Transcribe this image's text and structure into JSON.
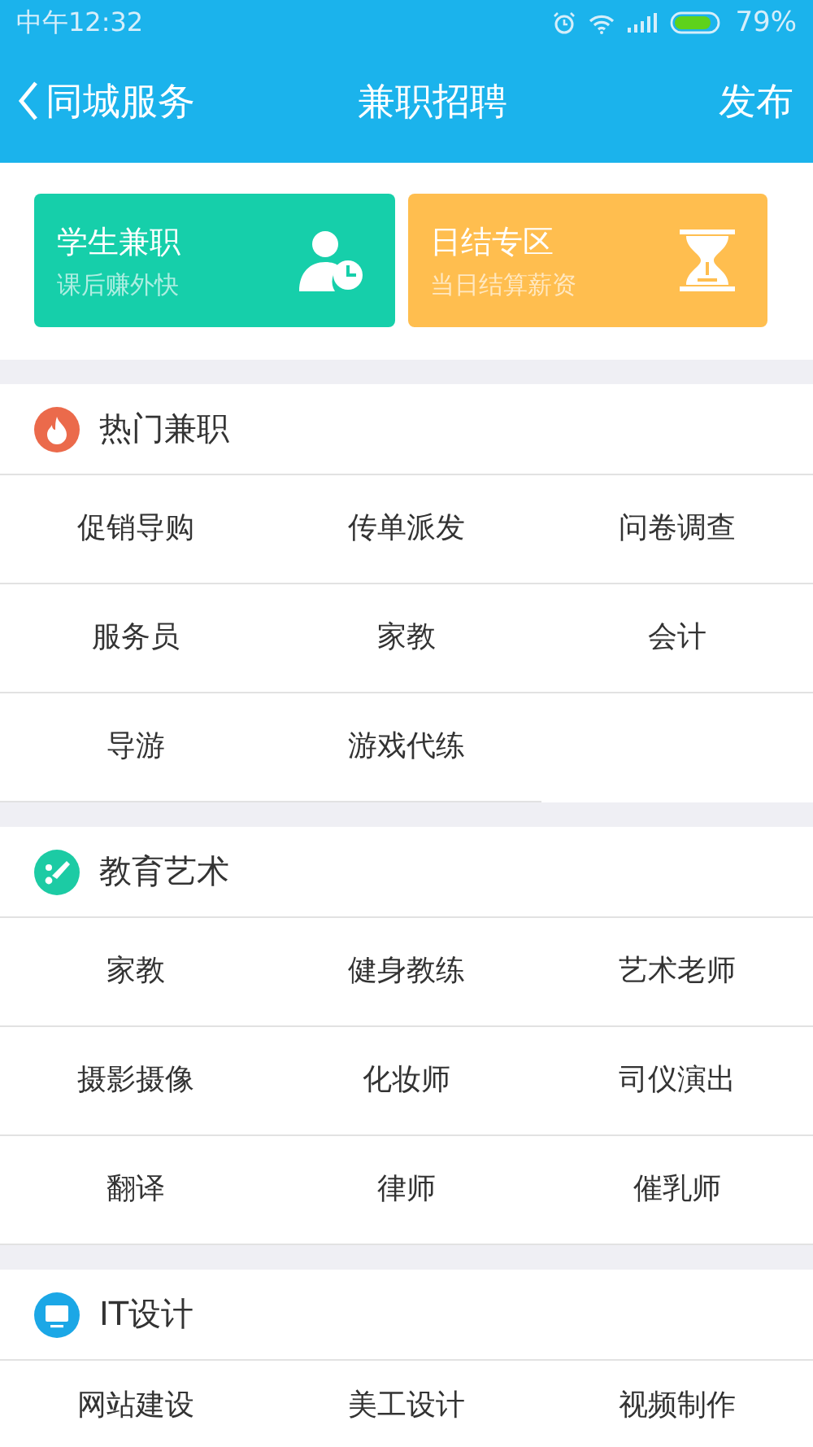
{
  "status_bar": {
    "time": "中午12:32",
    "battery": "79%"
  },
  "nav": {
    "back": "同城服务",
    "title": "兼职招聘",
    "action": "发布"
  },
  "cards": [
    {
      "kind": "student",
      "title": "学生兼职",
      "subtitle": "课后赚外快",
      "color": "#16cfaa"
    },
    {
      "kind": "daily",
      "title": "日结专区",
      "subtitle": "当日结算薪资",
      "color": "#ffbe4f"
    }
  ],
  "sections": [
    {
      "kind": "fire",
      "title": "热门兼职",
      "color": "#eb6a4b",
      "items": [
        "促销导购",
        "传单派发",
        "问卷调查",
        "服务员",
        "家教",
        "会计",
        "导游",
        "游戏代练"
      ]
    },
    {
      "kind": "education",
      "title": "教育艺术",
      "color": "#1ccba4",
      "items": [
        "家教",
        "健身教练",
        "艺术老师",
        "摄影摄像",
        "化妆师",
        "司仪演出",
        "翻译",
        "律师",
        "催乳师"
      ]
    },
    {
      "kind": "monitor",
      "title": "IT设计",
      "color": "#1ba7e6",
      "items": [
        "网站建设",
        "美工设计",
        "视频制作"
      ]
    }
  ]
}
